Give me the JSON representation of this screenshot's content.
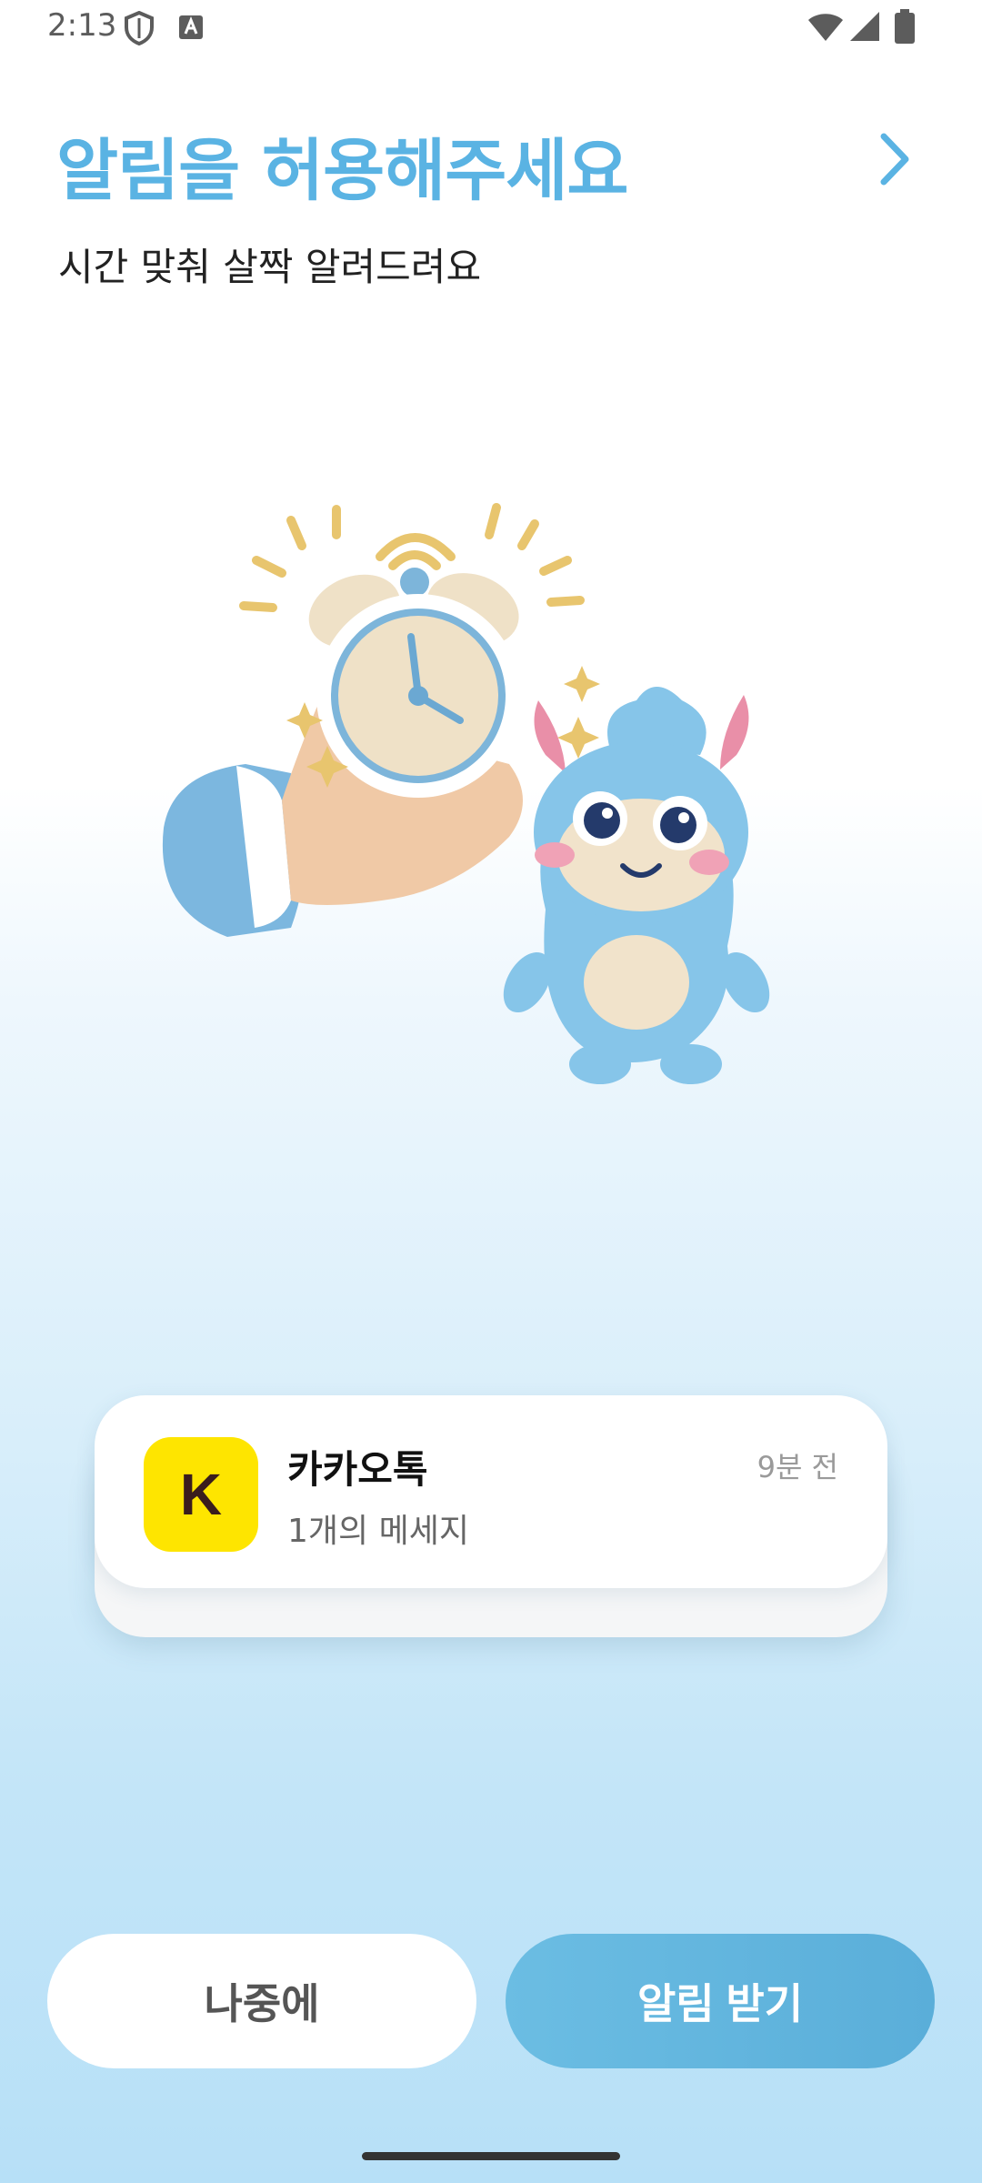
{
  "status_bar": {
    "time": "2:13",
    "icons": [
      "shield-icon",
      "a-box-icon",
      "wifi-icon",
      "signal-icon",
      "battery-icon"
    ]
  },
  "header": {
    "title": "알림을 허용해주세요",
    "subtitle": "시간 맞춰 살짝 알려드려요",
    "next_icon": "chevron-right-icon"
  },
  "illustration": {
    "description_icon": "alarm-clock-mascot-illustration"
  },
  "notification": {
    "app_icon_letter": "K",
    "app_name": "카카오톡",
    "time": "9분 전",
    "message": "1개의 메세지"
  },
  "buttons": {
    "later_label": "나중에",
    "allow_label": "알림 받기"
  },
  "colors": {
    "accent": "#5ab3e3",
    "kakao_yellow": "#fee500",
    "allow_button": "#62b6df"
  }
}
